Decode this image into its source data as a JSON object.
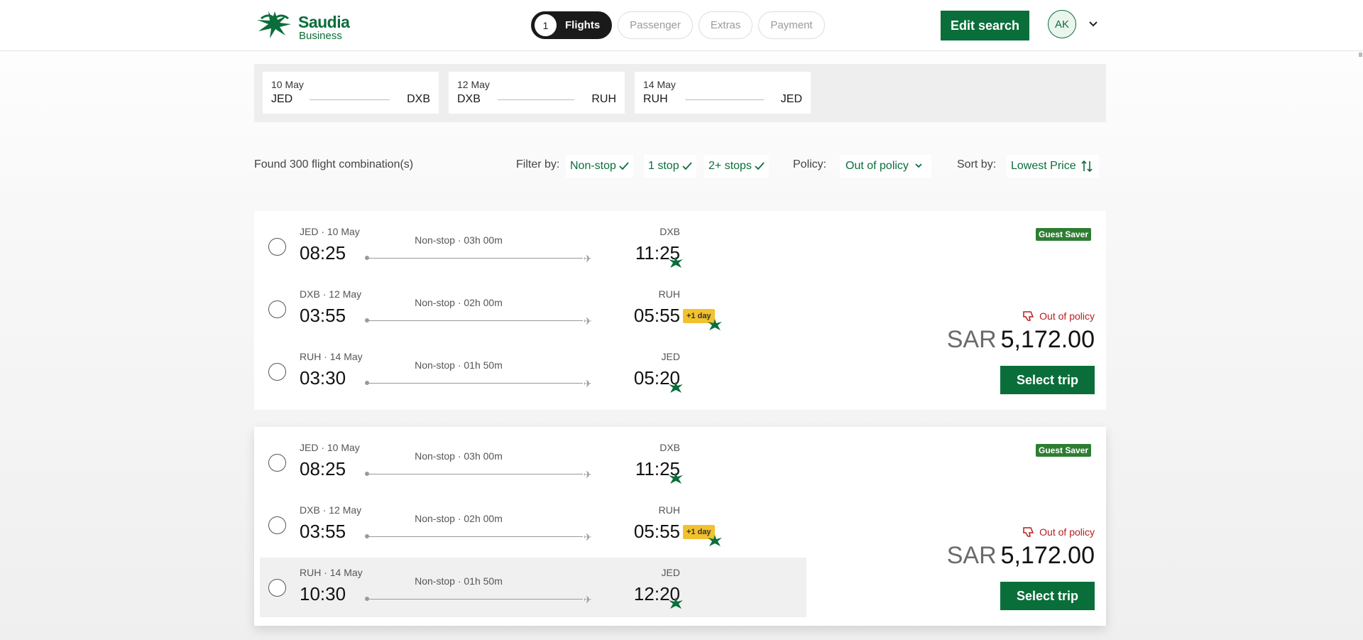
{
  "header": {
    "logo": {
      "brand": "Saudia",
      "sub": "Business"
    },
    "steps": [
      {
        "number": "1",
        "label": "Flights"
      },
      {
        "label": "Passenger"
      },
      {
        "label": "Extras"
      },
      {
        "label": "Payment"
      }
    ],
    "edit_search": "Edit search",
    "avatar": "AK"
  },
  "route_legs": [
    {
      "date": "10 May",
      "from": "JED",
      "to": "DXB"
    },
    {
      "date": "12 May",
      "from": "DXB",
      "to": "RUH"
    },
    {
      "date": "14 May",
      "from": "RUH",
      "to": "JED"
    }
  ],
  "toolbar": {
    "found": "Found 300 flight combination(s)",
    "filter_label": "Filter by:",
    "filters": [
      "Non-stop",
      "1 stop",
      "2+ stops"
    ],
    "policy_label": "Policy:",
    "policy_value": "Out of policy",
    "sort_label": "Sort by:",
    "sort_value": "Lowest Price"
  },
  "cards": [
    {
      "badge": "Guest Saver",
      "policy": "Out of policy",
      "currency": "SAR",
      "price": "5,172.00",
      "select": "Select trip",
      "segments": [
        {
          "dep_label": "JED · 10 May",
          "dep_time": "08:25",
          "duration": "Non-stop · 03h 00m",
          "arr_label": "DXB",
          "arr_time": "11:25",
          "plus_day": ""
        },
        {
          "dep_label": "DXB · 12 May",
          "dep_time": "03:55",
          "duration": "Non-stop · 02h 00m",
          "arr_label": "RUH",
          "arr_time": "05:55",
          "plus_day": "+1 day"
        },
        {
          "dep_label": "RUH · 14 May",
          "dep_time": "03:30",
          "duration": "Non-stop · 01h 50m",
          "arr_label": "JED",
          "arr_time": "05:20",
          "plus_day": ""
        }
      ]
    },
    {
      "badge": "Guest Saver",
      "policy": "Out of policy",
      "currency": "SAR",
      "price": "5,172.00",
      "select": "Select trip",
      "segments": [
        {
          "dep_label": "JED · 10 May",
          "dep_time": "08:25",
          "duration": "Non-stop · 03h 00m",
          "arr_label": "DXB",
          "arr_time": "11:25",
          "plus_day": ""
        },
        {
          "dep_label": "DXB · 12 May",
          "dep_time": "03:55",
          "duration": "Non-stop · 02h 00m",
          "arr_label": "RUH",
          "arr_time": "05:55",
          "plus_day": "+1 day"
        },
        {
          "dep_label": "RUH · 14 May",
          "dep_time": "10:30",
          "duration": "Non-stop · 01h 50m",
          "arr_label": "JED",
          "arr_time": "12:20",
          "plus_day": ""
        }
      ]
    }
  ],
  "colors": {
    "brand_green": "#0a6e3a",
    "badge_green": "#2e7d32",
    "policy_red": "#b71c1c",
    "plus_day_yellow": "#f2c12e"
  },
  "icons": {
    "logo": "saudia-palm-logo",
    "check": "check-icon",
    "chevron": "chevron-down-icon",
    "sort": "sort-arrows-icon",
    "thumbs_down": "thumbs-down-icon",
    "plane": "plane-icon",
    "airline": "saudia-airline-icon"
  }
}
